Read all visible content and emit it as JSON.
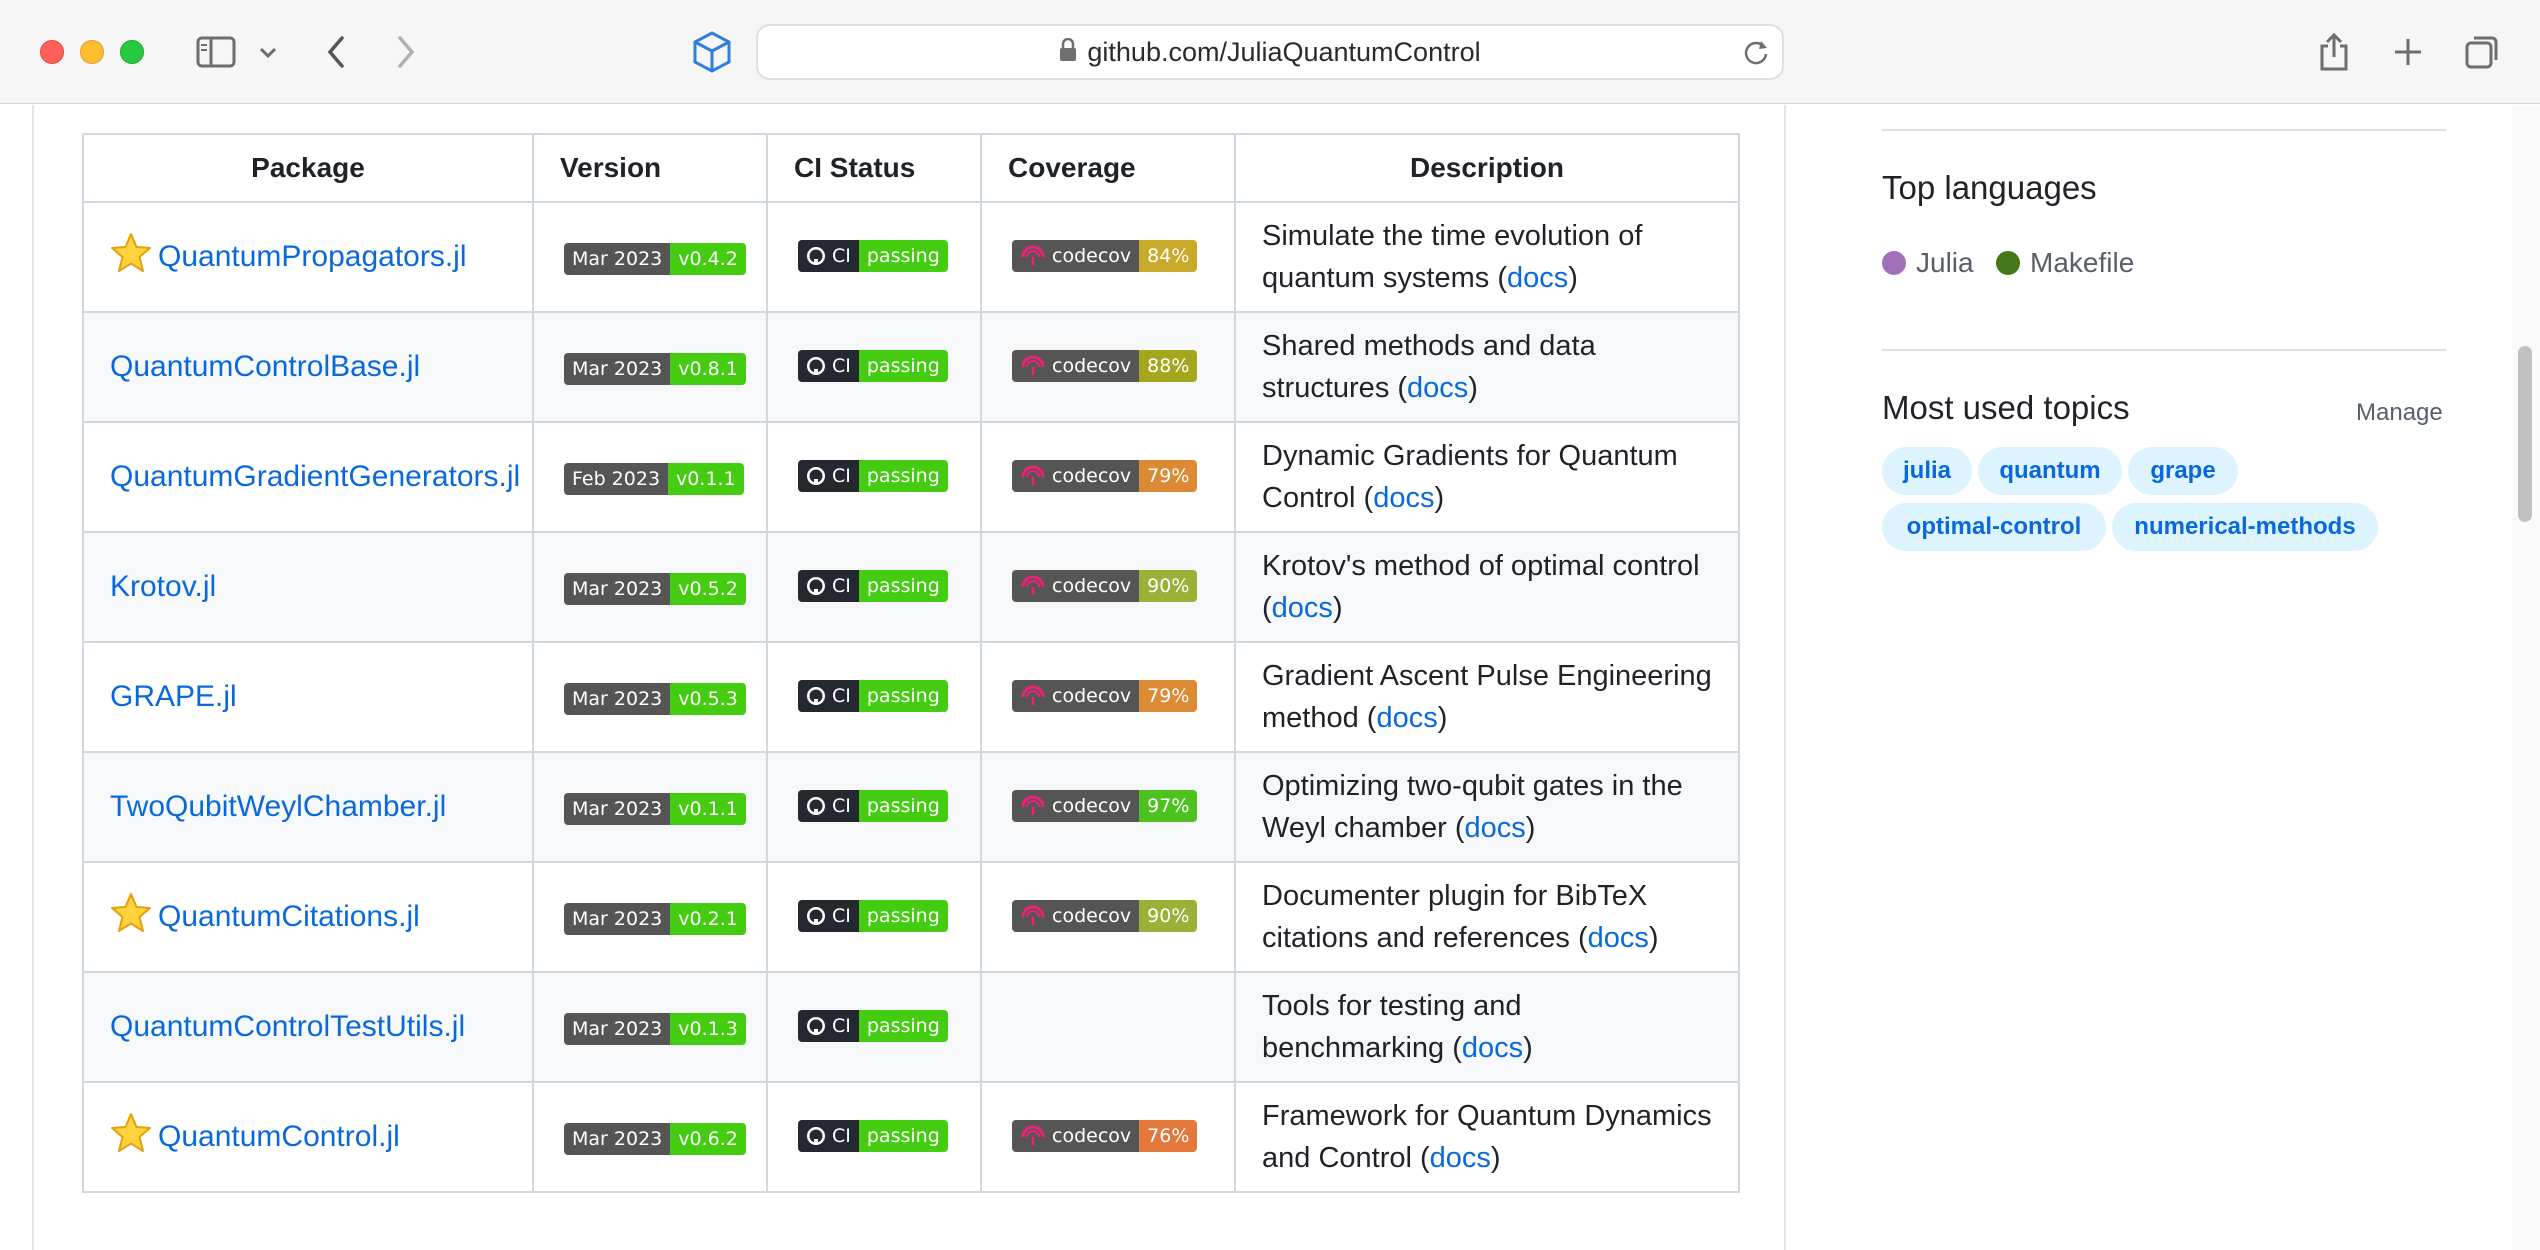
{
  "browser": {
    "url": "github.com/JuliaQuantumControl"
  },
  "table": {
    "headers": [
      "Package",
      "Version",
      "CI Status",
      "Coverage",
      "Description"
    ],
    "rows": [
      {
        "name": "QuantumPropagators.jl",
        "starred": true,
        "version_date": "Mar 2023",
        "version": "v0.4.2",
        "ci_label": "CI",
        "ci_status": "passing",
        "cov_label": "codecov",
        "coverage": "84%",
        "cov_color": "#c9a92a",
        "desc1": "Simulate the time evolution of",
        "desc2": "quantum systems (",
        "docs": "docs",
        "close": ")"
      },
      {
        "name": "QuantumControlBase.jl",
        "starred": false,
        "version_date": "Mar 2023",
        "version": "v0.8.1",
        "ci_label": "CI",
        "ci_status": "passing",
        "cov_label": "codecov",
        "coverage": "88%",
        "cov_color": "#a4a61d",
        "desc1": "Shared methods and data",
        "desc2": "structures (",
        "docs": "docs",
        "close": ")"
      },
      {
        "name": "QuantumGradientGenerators.jl",
        "starred": false,
        "version_date": "Feb 2023",
        "version": "v0.1.1",
        "ci_label": "CI",
        "ci_status": "passing",
        "cov_label": "codecov",
        "coverage": "79%",
        "cov_color": "#dd8a35",
        "desc1": "Dynamic Gradients for Quantum",
        "desc2": "Control (",
        "docs": "docs",
        "close": ")"
      },
      {
        "name": "Krotov.jl",
        "starred": false,
        "version_date": "Mar 2023",
        "version": "v0.5.2",
        "ci_label": "CI",
        "ci_status": "passing",
        "cov_label": "codecov",
        "coverage": "90%",
        "cov_color": "#97b237",
        "desc1": "Krotov's method of optimal control",
        "desc2": "(",
        "docs": "docs",
        "close": ")"
      },
      {
        "name": "GRAPE.jl",
        "starred": false,
        "version_date": "Mar 2023",
        "version": "v0.5.3",
        "ci_label": "CI",
        "ci_status": "passing",
        "cov_label": "codecov",
        "coverage": "79%",
        "cov_color": "#dd8a35",
        "desc1": "Gradient Ascent Pulse Engineering",
        "desc2": "method (",
        "docs": "docs",
        "close": ")"
      },
      {
        "name": "TwoQubitWeylChamber.jl",
        "starred": false,
        "version_date": "Mar 2023",
        "version": "v0.1.1",
        "ci_label": "CI",
        "ci_status": "passing",
        "cov_label": "codecov",
        "coverage": "97%",
        "cov_color": "#4dc21f",
        "desc1": "Optimizing two-qubit gates in the",
        "desc2": "Weyl chamber (",
        "docs": "docs",
        "close": ")"
      },
      {
        "name": "QuantumCitations.jl",
        "starred": true,
        "version_date": "Mar 2023",
        "version": "v0.2.1",
        "ci_label": "CI",
        "ci_status": "passing",
        "cov_label": "codecov",
        "coverage": "90%",
        "cov_color": "#97b237",
        "desc1": "Documenter plugin for BibTeX",
        "desc2": "citations and references (",
        "docs": "docs",
        "close": ")"
      },
      {
        "name": "QuantumControlTestUtils.jl",
        "starred": false,
        "version_date": "Mar 2023",
        "version": "v0.1.3",
        "ci_label": "CI",
        "ci_status": "passing",
        "cov_label": "",
        "coverage": "",
        "cov_color": "",
        "desc1": "Tools for testing and",
        "desc2": "benchmarking (",
        "docs": "docs",
        "close": ")"
      },
      {
        "name": "QuantumControl.jl",
        "starred": true,
        "version_date": "Mar 2023",
        "version": "v0.6.2",
        "ci_label": "CI",
        "ci_status": "passing",
        "cov_label": "codecov",
        "coverage": "76%",
        "cov_color": "#e3783a",
        "desc1": "Framework for Quantum Dynamics",
        "desc2": "and Control (",
        "docs": "docs",
        "close": ")"
      }
    ]
  },
  "sidebar": {
    "top_languages_title": "Top languages",
    "languages": [
      {
        "name": "Julia",
        "color": "#a270ba"
      },
      {
        "name": "Makefile",
        "color": "#427819"
      }
    ],
    "topics_title": "Most used topics",
    "manage_label": "Manage",
    "topics": [
      "julia",
      "quantum",
      "grape",
      "optimal-control",
      "numerical-methods"
    ]
  },
  "colors": {
    "link": "#0969da",
    "badge_green": "#4c1",
    "badge_dark": "#555555"
  }
}
